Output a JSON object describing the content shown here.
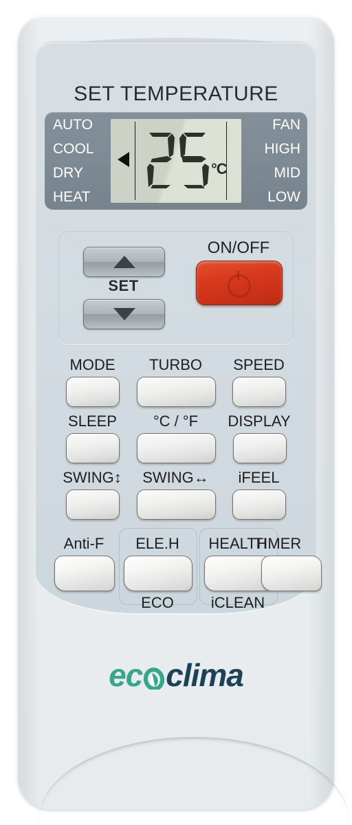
{
  "device": {
    "type": "air-conditioner-remote-control",
    "brand_logo": {
      "part1": "eco",
      "part2": "clima",
      "colors": {
        "eco": "#37a68b",
        "clima": "#1d4257"
      }
    }
  },
  "header": {
    "title": "SET TEMPERATURE"
  },
  "display": {
    "mode_labels": [
      "AUTO",
      "COOL",
      "DRY",
      "HEAT"
    ],
    "fan_labels": [
      "FAN",
      "HIGH",
      "MID",
      "LOW"
    ],
    "selected_mode": "COOL",
    "temperature": "25",
    "unit": "°C",
    "bezel_color": "#7d8993",
    "lcd_color": "#ccd2c5"
  },
  "set_group": {
    "up_label": "▲",
    "down_label": "▼",
    "set_label": "SET",
    "onoff_label": "ON/OFF",
    "onoff_color": "#d33a1d"
  },
  "buttons": [
    {
      "label": "MODE",
      "name": "mode"
    },
    {
      "label": "TURBO",
      "name": "turbo"
    },
    {
      "label": "SPEED",
      "name": "speed"
    },
    {
      "label": "SLEEP",
      "name": "sleep"
    },
    {
      "label": "°C / °F",
      "name": "celsius-fahrenheit"
    },
    {
      "label": "DISPLAY",
      "name": "display"
    },
    {
      "label": "SWING↕",
      "name": "swing-vertical"
    },
    {
      "label": "SWING↔",
      "name": "swing-horizontal"
    },
    {
      "label": "iFEEL",
      "name": "ifeel"
    }
  ],
  "bottom_buttons": [
    {
      "label": "Anti-F",
      "sub": "",
      "name": "anti-f"
    },
    {
      "label": "ELE.H",
      "sub": "ECO",
      "name": "ele-h-eco"
    },
    {
      "label": "HEALTH",
      "sub": "iCLEAN",
      "name": "health-iclean"
    },
    {
      "label": "TIMER",
      "sub": "",
      "name": "timer"
    }
  ]
}
